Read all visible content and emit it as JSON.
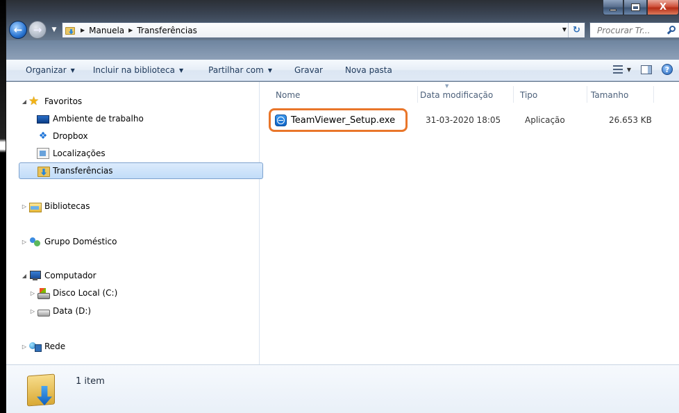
{
  "window": {
    "caption_buttons": {
      "minimize_icon": "minimize-icon",
      "maximize_icon": "maximize-icon",
      "close_label": "X"
    }
  },
  "address_bar": {
    "crumbs": [
      "Manuela",
      "Transferências"
    ],
    "refresh_icon": "refresh-icon"
  },
  "search": {
    "placeholder": "Procurar Tr..."
  },
  "toolbar": {
    "organize": "Organizar",
    "include_library": "Incluir na biblioteca",
    "share_with": "Partilhar com",
    "burn": "Gravar",
    "new_folder": "Nova pasta"
  },
  "nav_tree": {
    "favorites": {
      "label": "Favoritos",
      "items": [
        {
          "label": "Ambiente de trabalho",
          "icon": "desktop-icon"
        },
        {
          "label": "Dropbox",
          "icon": "dropbox-icon"
        },
        {
          "label": "Localizações",
          "icon": "recent-places-icon"
        },
        {
          "label": "Transferências",
          "icon": "downloads-folder-icon",
          "selected": true
        }
      ]
    },
    "libraries": "Bibliotecas",
    "homegroup": "Grupo Doméstico",
    "computer": {
      "label": "Computador",
      "items": [
        {
          "label": "Disco Local (C:)",
          "icon": "local-disk-icon"
        },
        {
          "label": "Data (D:)",
          "icon": "drive-icon"
        }
      ]
    },
    "network": "Rede"
  },
  "file_list": {
    "columns": [
      "Nome",
      "Data modificação",
      "Tipo",
      "Tamanho"
    ],
    "rows": [
      {
        "name": "TeamViewer_Setup.exe",
        "modified": "31-03-2020 18:05",
        "type": "Aplicação",
        "size": "26.653 KB",
        "icon": "teamviewer-icon",
        "highlighted": true
      }
    ]
  },
  "status_bar": {
    "text": "1 item"
  },
  "colors": {
    "highlight_border": "#e9762a",
    "selection": "#c1dcf8",
    "toolbar_text": "#1e395b"
  }
}
